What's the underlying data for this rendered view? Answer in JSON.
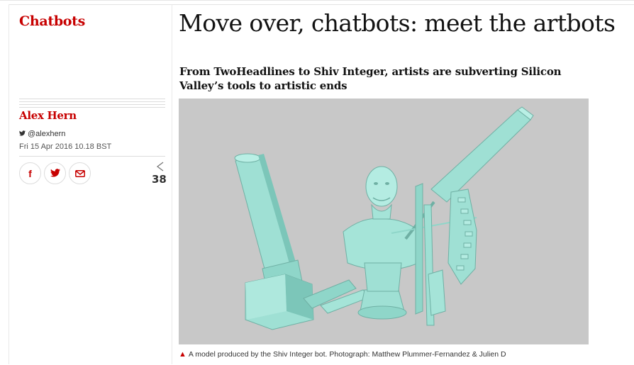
{
  "section": {
    "label": "Chatbots"
  },
  "article": {
    "headline": "Move over, chatbots: meet the artbots",
    "standfirst": "From TwoHeadlines to Shiv Integer, artists are subverting Silicon Valley’s tools to artistic ends"
  },
  "byline": {
    "author": "Alex Hern",
    "twitter_handle": "@alexhern",
    "date": "Fri 15 Apr 2016 10.18 BST"
  },
  "share": {
    "facebook_icon": "f",
    "twitter_icon": "twitter-bird",
    "email_icon": "envelope",
    "count": "38"
  },
  "image": {
    "caption": "A model produced by the Shiv Integer bot. Photograph: Matthew Plummer-Fernandez & Julien D"
  },
  "colors": {
    "accent": "#c70000",
    "model": "#9fe0d4",
    "image_bg": "#c8c8c8"
  }
}
